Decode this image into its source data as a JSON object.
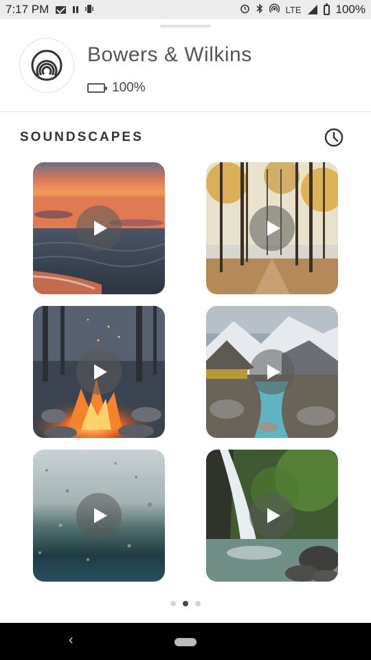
{
  "status_bar": {
    "time": "7:17 PM",
    "network": "LTE",
    "battery": "100%"
  },
  "header": {
    "device_name": "Bowers & Wilkins",
    "battery_text": "100%",
    "battery_level": 1.0
  },
  "section": {
    "title": "SOUNDSCAPES"
  },
  "tiles": [
    {
      "icon": "sunset-beach-image"
    },
    {
      "icon": "autumn-forest-image"
    },
    {
      "icon": "campfire-image"
    },
    {
      "icon": "mountain-stream-image"
    },
    {
      "icon": "rain-window-image"
    },
    {
      "icon": "waterfall-image"
    }
  ],
  "pager": {
    "pages": 3,
    "active": 2
  },
  "colors": {
    "accent": "#333333",
    "divider": "#e3e3e3"
  }
}
